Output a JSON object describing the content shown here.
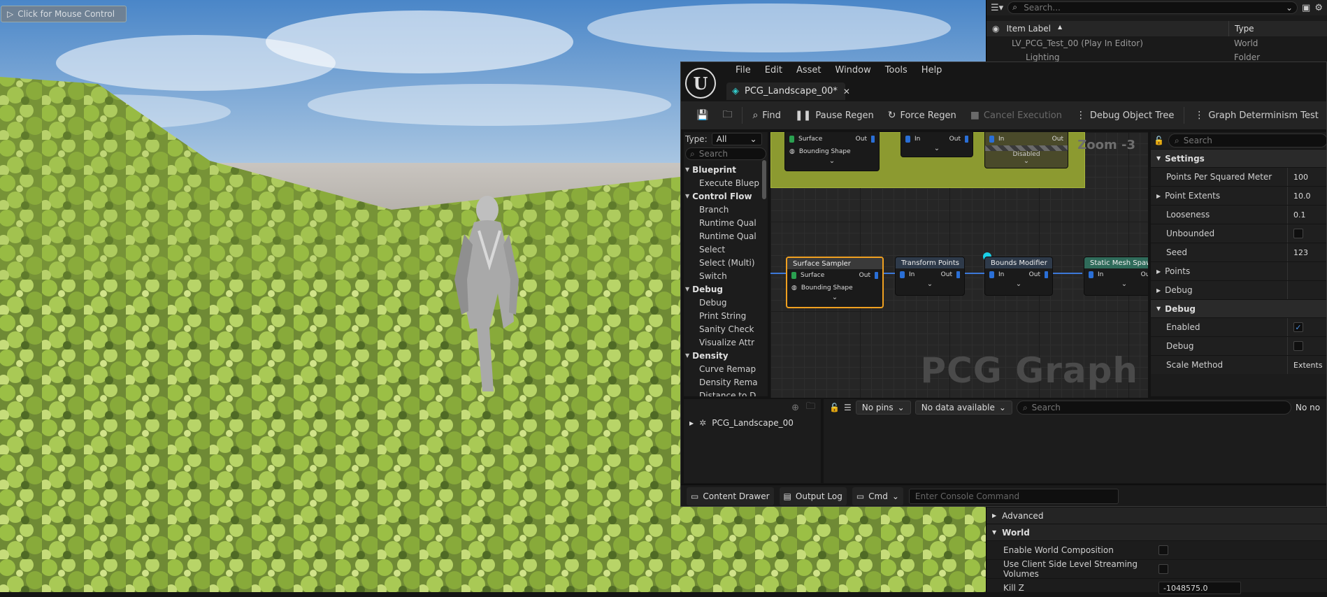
{
  "viewport": {
    "mouse_control_label": "Click for Mouse Control"
  },
  "outliner": {
    "search_placeholder": "Search...",
    "col_item_label": "Item Label",
    "col_type": "Type",
    "rows": [
      {
        "label": "LV_PCG_Test_00 (Play In Editor)",
        "type": "World"
      },
      {
        "label": "Lighting",
        "type": "Folder"
      }
    ]
  },
  "editor": {
    "menus": [
      "File",
      "Edit",
      "Asset",
      "Window",
      "Tools",
      "Help"
    ],
    "tab_title": "PCG_Landscape_00*",
    "toolbar": {
      "find": "Find",
      "pause_regen": "Pause Regen",
      "force_regen": "Force Regen",
      "cancel_execution": "Cancel Execution",
      "debug_object_tree": "Debug Object Tree",
      "graph_determinism": "Graph Determinism Test"
    },
    "palette": {
      "type_label": "Type:",
      "type_value": "All",
      "search_placeholder": "Search",
      "categories": [
        {
          "name": "Blueprint",
          "items": [
            "Execute Bluep"
          ]
        },
        {
          "name": "Control Flow",
          "items": [
            "Branch",
            "Runtime Qual",
            "Runtime Qual",
            "Select",
            "Select (Multi)",
            "Switch"
          ]
        },
        {
          "name": "Debug",
          "items": [
            "Debug",
            "Print String",
            "Sanity Check",
            "Visualize Attr"
          ]
        },
        {
          "name": "Density",
          "items": [
            "Curve Remap",
            "Density Rema",
            "Distance to D"
          ]
        }
      ]
    },
    "graph": {
      "zoom": "Zoom -3",
      "watermark": "PCG Graph",
      "top_node": {
        "pin_surface": "Surface",
        "pin_out": "Out",
        "pin_bounding": "Bounding Shape"
      },
      "mid_node": {
        "pin_in": "In",
        "pin_out": "Out"
      },
      "disabled_node": {
        "pin_in": "In",
        "pin_out": "Out",
        "label": "Disabled"
      },
      "nodes": [
        {
          "title": "Surface Sampler",
          "pin1": "Surface",
          "out": "Out",
          "pin2": "Bounding Shape"
        },
        {
          "title": "Transform Points",
          "in": "In",
          "out": "Out"
        },
        {
          "title": "Bounds Modifier",
          "in": "In",
          "out": "Out"
        },
        {
          "title": "Static Mesh Spawner",
          "in": "In",
          "out": "Out"
        }
      ]
    },
    "details": {
      "search_placeholder": "Search",
      "settings_header": "Settings",
      "rows": [
        {
          "label": "Points Per Squared Meter",
          "value": "100"
        },
        {
          "label": "Point Extents",
          "value": "10.0"
        },
        {
          "label": "Looseness",
          "value": "0.1"
        },
        {
          "label": "Unbounded",
          "value": ""
        },
        {
          "label": "Seed",
          "value": "123"
        }
      ],
      "points": "Points",
      "debug_collapsed": "Debug",
      "debug_header": "Debug",
      "debug_rows": [
        {
          "label": "Enabled",
          "checked": true
        },
        {
          "label": "Debug",
          "checked": false
        },
        {
          "label": "Scale Method",
          "value": "Extents"
        }
      ]
    },
    "tree": {
      "root": "PCG_Landscape_00"
    },
    "inspect": {
      "pins_dropdown": "No pins",
      "data_dropdown": "No data available",
      "search_placeholder": "Search",
      "right_text": "No no"
    },
    "statusbar": {
      "content_drawer": "Content Drawer",
      "output_log": "Output Log",
      "cmd": "Cmd",
      "console_placeholder": "Enter Console Command"
    }
  },
  "world_settings": {
    "advanced": "Advanced",
    "world": "World",
    "rows": [
      {
        "label": "Enable World Composition"
      },
      {
        "label": "Use Client Side Level Streaming Volumes"
      },
      {
        "label": "Kill Z",
        "value": "-1048575.0"
      }
    ]
  }
}
